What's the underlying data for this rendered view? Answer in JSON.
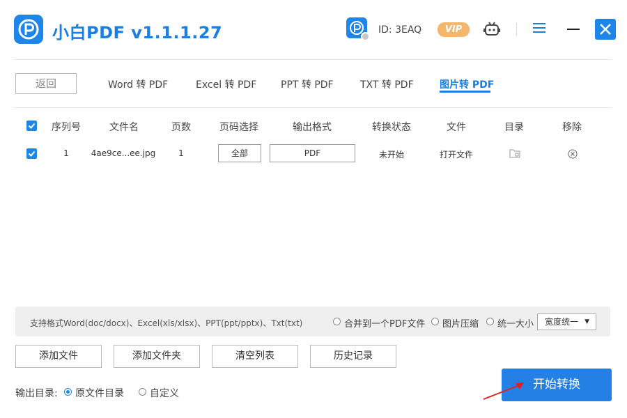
{
  "app": {
    "title": "小白PDF v1.1.1.27",
    "user_id": "ID: 3EAQ",
    "vip_label": "VIP"
  },
  "colors": {
    "accent": "#1e86e8",
    "vip": "#f4b66a",
    "arrow": "#e02020"
  },
  "back_button": "返回",
  "tabs": [
    {
      "label": "Word 转 PDF",
      "active": false
    },
    {
      "label": "Excel 转 PDF",
      "active": false
    },
    {
      "label": "PPT 转 PDF",
      "active": false
    },
    {
      "label": "TXT 转 PDF",
      "active": false
    },
    {
      "label": "图片转 PDF",
      "active": true
    }
  ],
  "table": {
    "headers": [
      "序列号",
      "文件名",
      "页数",
      "页码选择",
      "输出格式",
      "转换状态",
      "文件",
      "目录",
      "移除"
    ],
    "rows": [
      {
        "checked": true,
        "index": "1",
        "filename": "4ae9ce...ee.jpg",
        "pages": "1",
        "page_select": "全部",
        "format": "PDF",
        "status": "未开始",
        "open_file": "打开文件",
        "folder_icon": "folder-icon",
        "remove_icon": "circle-x-icon"
      }
    ]
  },
  "options": {
    "supported": "支持格式Word(doc/docx)、Excel(xls/xlsx)、PPT(ppt/pptx)、Txt(txt)",
    "merge": "合并到一个PDF文件",
    "compress": "图片压缩",
    "uniform_size": "统一大小",
    "size_select": "宽度统一"
  },
  "actions": {
    "add_file": "添加文件",
    "add_folder": "添加文件夹",
    "clear_list": "清空列表",
    "history": "历史记录"
  },
  "output": {
    "label": "输出目录:",
    "original": "原文件目录",
    "custom": "自定义",
    "selected": "original"
  },
  "start_button": "开始转换"
}
